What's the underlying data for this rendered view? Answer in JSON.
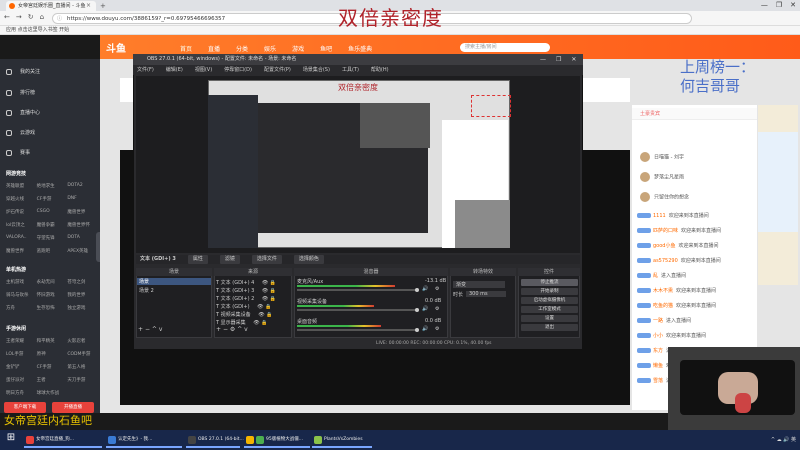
{
  "browser": {
    "tab_title": "女帝宫廷娱乐圈_直播间 - 斗鱼",
    "url": "https://www.douyu.com/3886159?_r=0.69795466696357",
    "bookmarks": "应用 点击这里导入书签  开始",
    "window_controls": [
      "—",
      "❐",
      "✕"
    ]
  },
  "overlay": {
    "title": "双倍亲密度",
    "rank_text": "上周榜一：\n何吉哥哥",
    "bottom_text": "女帝宫廷内石鱼吧"
  },
  "douyu": {
    "logo": "斗鱼",
    "nav": [
      "首页",
      "直播",
      "分类",
      "娱乐",
      "游戏",
      "鱼吧",
      "鱼乐盛典"
    ],
    "search_placeholder": "搜索主播/房间"
  },
  "sidebar": {
    "top_items": [
      "我的关注",
      "排行榜",
      "直播中心",
      "云游戏",
      "赛事"
    ],
    "section1": "网游竞技",
    "grid1": [
      "英雄联盟",
      "绝地求生",
      "DOTA2",
      "穿越火线",
      "CF手游",
      "DNF",
      "炉石传说",
      "CSGO",
      "魔兽世界",
      "lol云顶之",
      "魔兽争霸",
      "魔兽世界怀",
      "VALORA..",
      "守望先锋",
      "DOTA",
      "魔兽世界",
      "逃跑吧",
      "APEX英雄"
    ],
    "section2": "单机热游",
    "grid2": [
      "主机游戏",
      "永劫无间",
      "苍穹之剑",
      "骑马与砍杀",
      "怀旧游戏",
      "我的世界",
      "方舟",
      "生存恐怖",
      "独立游戏"
    ],
    "section3": "手游休闲",
    "grid3": [
      "王者荣耀",
      "和平精英",
      "火影忍者",
      "LOL手游",
      "原神",
      "CODM手游",
      "金铲铲",
      "CF手游",
      "第五人格",
      "蛋仔派对",
      "王者",
      "天刀手游",
      "明日方舟",
      "球球大作战"
    ],
    "buttons": [
      "客户端下载",
      "开播直播"
    ]
  },
  "obs": {
    "title": "OBS 27.0.1 (64-bit, windows) - 配置文件: 未命名 - 场景: 未命名",
    "menu": [
      "文件(F)",
      "编辑(E)",
      "视图(V)",
      "停靠窗口(D)",
      "配置文件(P)",
      "场景集合(S)",
      "工具(T)",
      "帮助(H)"
    ],
    "source_label": "文本 (GDI+) 3",
    "source_buttons": [
      "属性",
      "滤镜",
      "选择文件",
      "选择颜色"
    ],
    "inner_title": "双倍亲密度",
    "docks": {
      "scenes": "场景",
      "sources": "来源",
      "mixer": "混音器",
      "transitions": "转场特效",
      "controls": "控件"
    },
    "scenes": [
      "场景",
      "场景 2"
    ],
    "sources": [
      "文本 (GDI+) 4",
      "文本 (GDI+) 3",
      "文本 (GDI+) 2",
      "文本 (GDI+)",
      "视频采集设备",
      "显示器采集"
    ],
    "mixer": [
      {
        "name": "麦克风/Aux",
        "db": "-13.1 dB",
        "level": 0.7
      },
      {
        "name": "视频采集设备",
        "db": "0.0 dB",
        "level": 0.55
      },
      {
        "name": "桌面音频",
        "db": "0.0 dB",
        "level": 0.6
      }
    ],
    "transition": {
      "type": "渐变",
      "duration_label": "时长",
      "duration": "300 ms"
    },
    "controls": [
      "停止推流",
      "开始录制",
      "启动虚拟摄像机",
      "工作室模式",
      "设置",
      "退出"
    ],
    "status": "LIVE: 00:00:00   REC: 00:00:00   CPU: 0.1%, 40.00 fps"
  },
  "chat": {
    "rank_header": "土豪贵宾",
    "rank_rows": [
      "日喵猫 - 刘宇",
      "梦落尘凡星雨",
      "只留住你的想念"
    ],
    "lines": [
      {
        "user": "1111",
        "msg": "欢迎来到本直播间"
      },
      {
        "user": "匹萨的口味",
        "msg": "欢迎来到本直播间"
      },
      {
        "user": "good小鱼",
        "msg": "欢迎来到本直播间"
      },
      {
        "user": "as575290",
        "msg": "欢迎来到本直播间"
      },
      {
        "user": "乱",
        "msg": "进入直播间"
      },
      {
        "user": "木木不熏",
        "msg": "欢迎来到本直播间"
      },
      {
        "user": "吃鱼的猫",
        "msg": "欢迎来到本直播间"
      },
      {
        "user": "一路",
        "msg": "进入直播间"
      },
      {
        "user": "小小",
        "msg": "欢迎来到本直播间"
      },
      {
        "user": "东方",
        "msg": "进入直播间"
      },
      {
        "user": "懒鱼",
        "msg": "欢迎来到本直播间"
      },
      {
        "user": "雪落",
        "msg": "进入直播间"
      }
    ]
  },
  "taskbar": {
    "items": [
      "女帝宫廷直播_狗...",
      "认定先生》- 我...",
      "OBS 27.0.1 (64-bit...",
      "",
      "95版植物大战僵...",
      "PlantsVsZombies"
    ],
    "tray": "^ ☁ 🔊 英"
  },
  "colors": {
    "brand": "#fe6a00",
    "overlay_red": "#b0232a",
    "overlay_blue": "#4a6fc8",
    "sidebar_bg": "#2b2e35"
  }
}
